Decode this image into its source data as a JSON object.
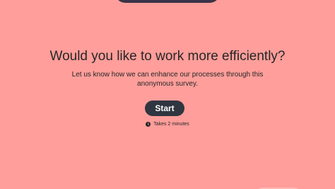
{
  "survey": {
    "title": "Would you like to work more efficiently?",
    "description": "Let us know how we can enhance our processes through this anonymous survey.",
    "start_label": "Start",
    "duration_text": "Takes 2 minutes",
    "duration_icon": "clock-icon"
  },
  "colors": {
    "background": "#ff9e9a",
    "button": "#2f3640",
    "button_text": "#ffffff",
    "text": "#262626"
  }
}
